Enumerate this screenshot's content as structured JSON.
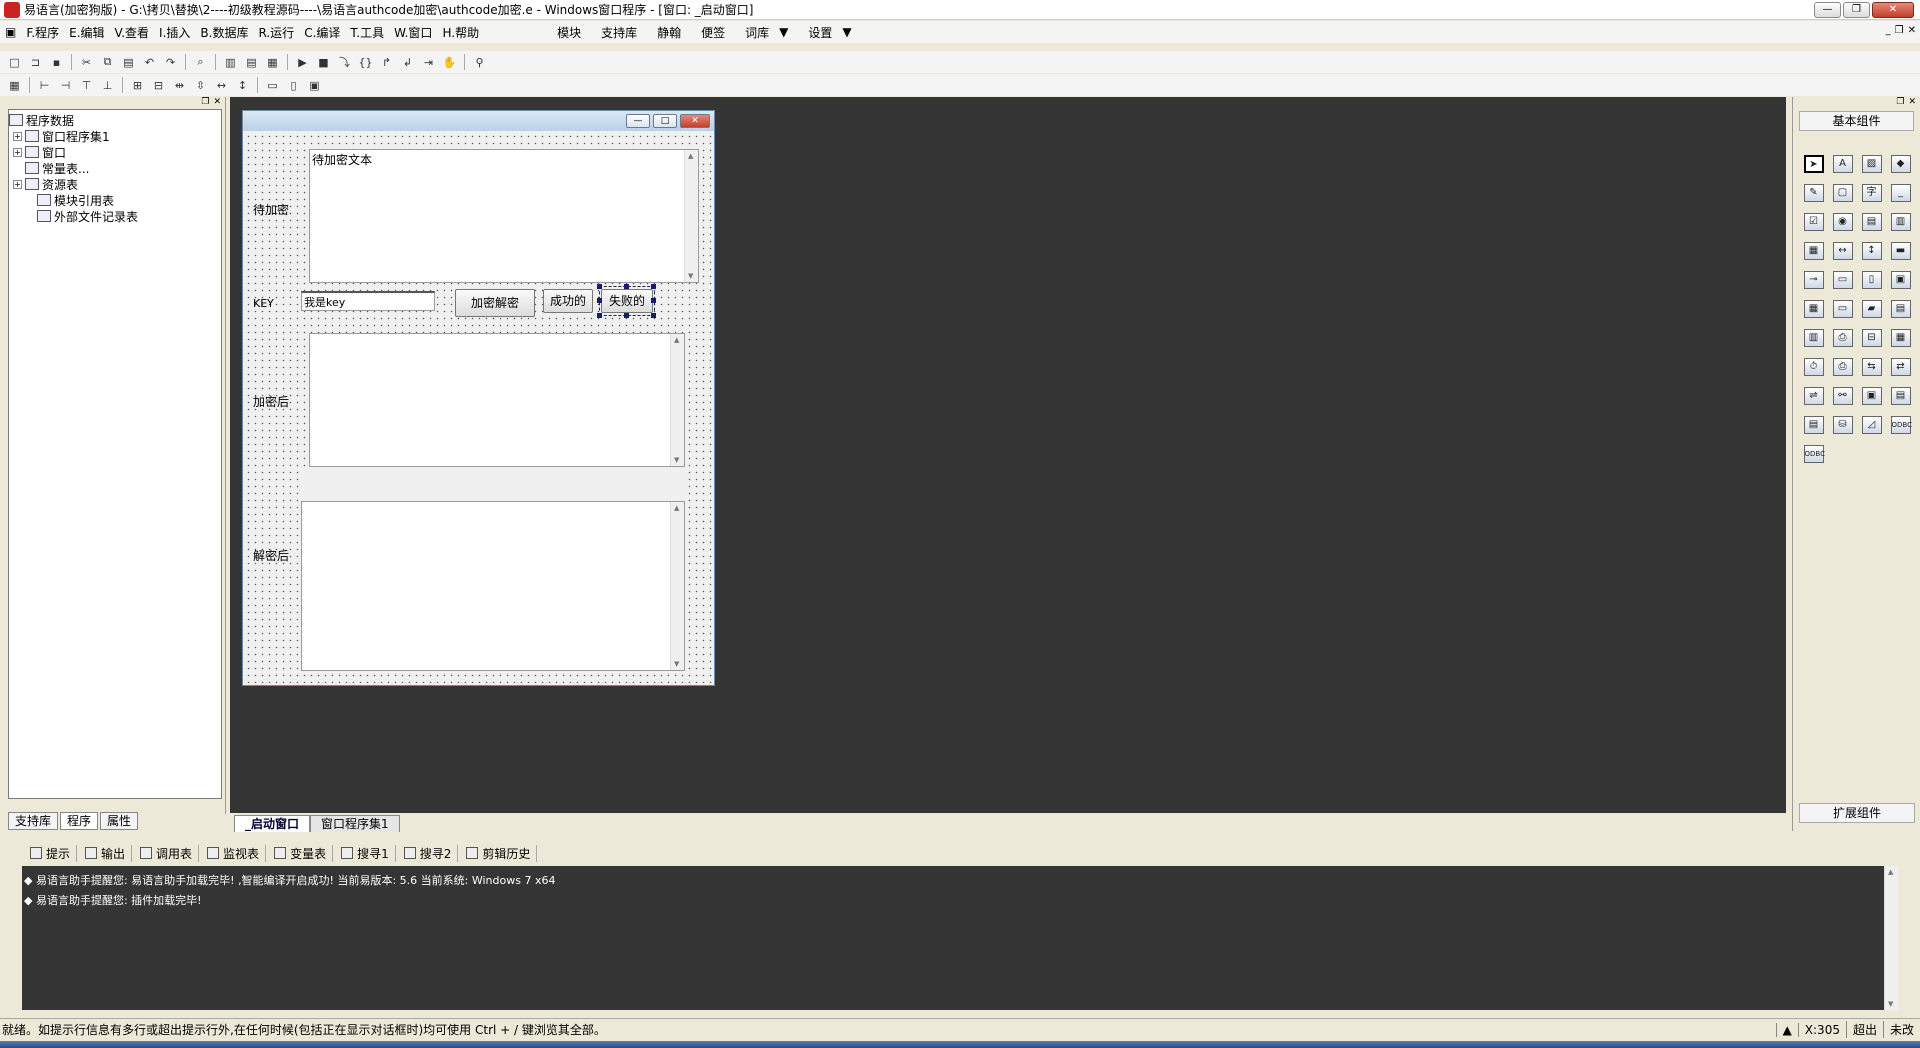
{
  "window": {
    "title": "易语言(加密狗版) - G:\\拷贝\\替换\\2----初级教程源码----\\易语言authcode加密\\authcode加密.e - Windows窗口程序 - [窗口: _启动窗口]"
  },
  "menu": {
    "items": [
      "F.程序",
      "E.编辑",
      "V.查看",
      "I.插入",
      "B.数据库",
      "R.运行",
      "C.编译",
      "T.工具",
      "W.窗口",
      "H.帮助"
    ],
    "extra": [
      "模块",
      "支持库",
      "静翰",
      "便签",
      "词库",
      "设置"
    ]
  },
  "left_panel": {
    "tree": [
      {
        "label": "程序数据",
        "expander": ""
      },
      {
        "label": "窗口程序集1",
        "expander": "+"
      },
      {
        "label": "窗口",
        "expander": "+"
      },
      {
        "label": "常量表...",
        "expander": ""
      },
      {
        "label": "资源表",
        "expander": "+"
      },
      {
        "label": "模块引用表",
        "expander": ""
      },
      {
        "label": "外部文件记录表",
        "expander": ""
      }
    ],
    "tabs": [
      "支持库",
      "程序",
      "属性"
    ]
  },
  "design_window": {
    "label_encrypt_in": "待加密",
    "input_text": "待加密文本",
    "label_key": "KEY",
    "key_value": "我是key",
    "btn_encrypt": "加密解密",
    "btn_success": "成功的",
    "btn_fail": "失败的",
    "label_encrypted": "加密后",
    "label_decrypted": "解密后"
  },
  "doc_tabs": [
    "_启动窗口",
    "窗口程序集1"
  ],
  "right_panel": {
    "title": "基本组件",
    "footer": "扩展组件",
    "icons": [
      "pointer",
      "AI",
      "图",
      "盾",
      "笔",
      "ab",
      "字",
      "—",
      "☑",
      "◉",
      "▤",
      "▦",
      "▥",
      "◫",
      "▮",
      "▯",
      "▭",
      "▬",
      "▣",
      "☐",
      "▢",
      "▤",
      "▥",
      "▦",
      "▧",
      "▨",
      "▩",
      "▪",
      "⏱",
      "▫",
      "▲",
      "△",
      "▼",
      "▽",
      "◆",
      "◇",
      "○",
      "●",
      "◎",
      "◐",
      "ODBC",
      "ODBC"
    ]
  },
  "output_tabs": [
    "提示",
    "输出",
    "调用表",
    "监视表",
    "变量表",
    "搜寻1",
    "搜寻2",
    "剪辑历史"
  ],
  "output_lines": [
    "◆ 易语言助手提醒您: 易语言助手加载完毕! ,智能编译开启成功! 当前易版本: 5.6 当前系统: Windows 7 x64",
    "◆ 易语言助手提醒您: 插件加载完毕!"
  ],
  "status": {
    "message": "就绪。如提示行信息有多行或超出提示行外,在任何时候(包括正在显示对话框时)均可使用 Ctrl + / 键浏览其全部。",
    "coord": "X:305",
    "mode": "超出",
    "state": "未改"
  }
}
